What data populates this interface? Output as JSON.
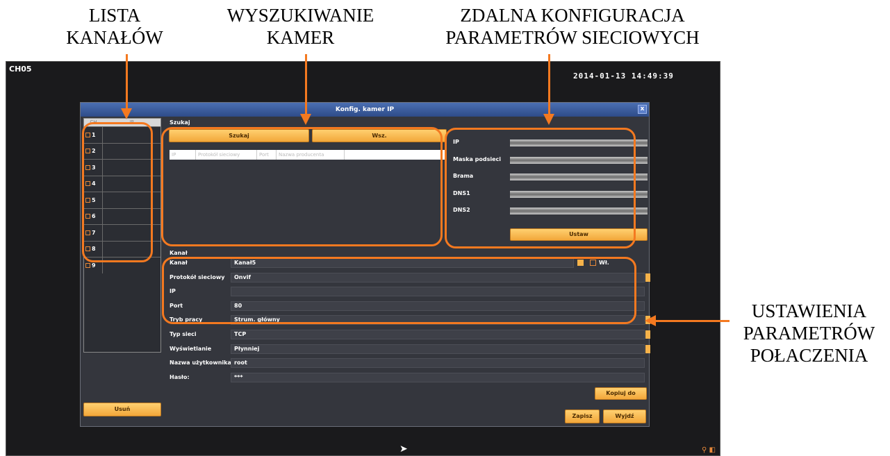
{
  "annotations": {
    "channels": [
      "LISTA",
      "KANAŁÓW"
    ],
    "search": [
      "WYSZUKIWANIE",
      "KAMER"
    ],
    "network": [
      "ZDALNA KONFIGURACJA",
      "PARAMETRÓW SIECIOWYCH"
    ],
    "connection": [
      "USTAWIENIA",
      "PARAMETRÓW",
      "POŁACZENIA"
    ]
  },
  "screen": {
    "channel": "CH05",
    "datetime": "2014-01-13 14:49:39"
  },
  "dialog": {
    "title": "Konfig. kamer IP",
    "close": "x"
  },
  "channel_list": {
    "headers": [
      "CH",
      "IP"
    ],
    "items": [
      "1",
      "2",
      "3",
      "4",
      "5",
      "6",
      "7",
      "8",
      "9"
    ],
    "delete_button": "Usuń"
  },
  "search": {
    "section": "Szukaj",
    "search_button": "Szukaj",
    "all_button": "Wsz.",
    "columns": [
      "IP",
      "Protokół sieciowy",
      "Port",
      "Nazwa producenta"
    ]
  },
  "network": {
    "labels": [
      "IP",
      "Maska podsieci",
      "Brama",
      "DNS1",
      "DNS2"
    ],
    "set_button": "Ustaw"
  },
  "channel": {
    "section": "Kanał",
    "enable_label": "Wł.",
    "fields": [
      {
        "label": "Kanał",
        "value": "Kanał5"
      },
      {
        "label": "Protokół sieciowy",
        "value": "Onvif"
      },
      {
        "label": "IP",
        "value": ""
      },
      {
        "label": "Port",
        "value": "80"
      },
      {
        "label": "Tryb pracy",
        "value": "Strum. główny"
      },
      {
        "label": "Typ sieci",
        "value": "TCP"
      },
      {
        "label": "Wyświetlanie",
        "value": "Płynniej"
      },
      {
        "label": "Nazwa użytkownika",
        "value": "root"
      },
      {
        "label": "Hasło:",
        "value": "***"
      }
    ]
  },
  "buttons": {
    "copy": "Kopiuj do",
    "save": "Zapisz",
    "exit": "Wyjdź"
  }
}
